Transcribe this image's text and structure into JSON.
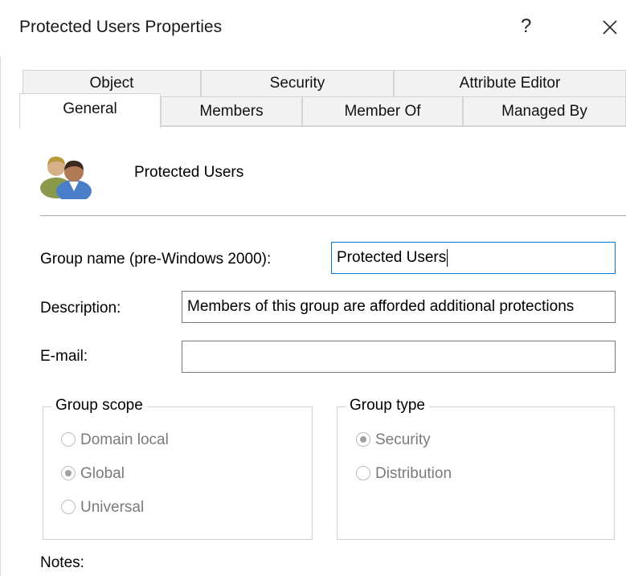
{
  "window": {
    "title": "Protected Users Properties",
    "help_glyph": "?",
    "close_icon": "close-icon"
  },
  "tabs": {
    "row1": [
      "Object",
      "Security",
      "Attribute Editor"
    ],
    "row2": [
      "General",
      "Members",
      "Member Of",
      "Managed By"
    ],
    "active": "General"
  },
  "general": {
    "group_icon": "group-users-icon",
    "group_display_name": "Protected Users",
    "pre2000_label": "Group name (pre-Windows 2000):",
    "pre2000_value": "Protected Users",
    "description_label": "Description:",
    "description_value": "Members of this group are afforded additional protections",
    "email_label": "E-mail:",
    "email_value": "",
    "notes_label": "Notes:"
  },
  "group_scope": {
    "title": "Group scope",
    "options": [
      "Domain local",
      "Global",
      "Universal"
    ],
    "selected": "Global",
    "enabled": false
  },
  "group_type": {
    "title": "Group type",
    "options": [
      "Security",
      "Distribution"
    ],
    "selected": "Security",
    "enabled": false
  },
  "colors": {
    "focus_border": "#0078d7",
    "disabled_text": "#7a7a7a"
  }
}
